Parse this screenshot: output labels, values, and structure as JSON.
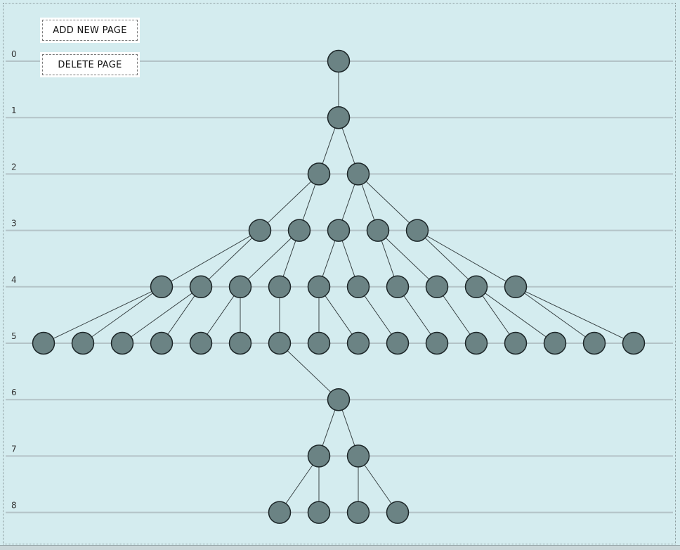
{
  "toolbar": {
    "add_label": "ADD NEW PAGE",
    "delete_label": "DELETE PAGE"
  },
  "levels": [
    "0",
    "1",
    "2",
    "3",
    "4",
    "5",
    "6",
    "7",
    "8"
  ],
  "colors": {
    "background": "#d4ecef",
    "node_fill": "#6b8384",
    "node_stroke": "#1c2628",
    "level_line": "#b3c3c7"
  },
  "tree": {
    "nodes": [
      {
        "id": "r",
        "level": 0
      },
      {
        "id": "a",
        "level": 1,
        "parent": "r"
      },
      {
        "id": "b1",
        "level": 2,
        "parent": "a"
      },
      {
        "id": "b2",
        "level": 2,
        "parent": "a"
      },
      {
        "id": "c1",
        "level": 3,
        "parent": "b1"
      },
      {
        "id": "c2",
        "level": 3,
        "parent": "b1"
      },
      {
        "id": "c3",
        "level": 3,
        "parent": "b2"
      },
      {
        "id": "c4",
        "level": 3,
        "parent": "b2"
      },
      {
        "id": "c5",
        "level": 3,
        "parent": "b2"
      },
      {
        "id": "d1",
        "level": 4,
        "parent": "c1"
      },
      {
        "id": "d2",
        "level": 4,
        "parent": "c1"
      },
      {
        "id": "d3",
        "level": 4,
        "parent": "c2"
      },
      {
        "id": "d4",
        "level": 4,
        "parent": "c2"
      },
      {
        "id": "d5",
        "level": 4,
        "parent": "c3"
      },
      {
        "id": "d6",
        "level": 4,
        "parent": "c3"
      },
      {
        "id": "d7",
        "level": 4,
        "parent": "c4"
      },
      {
        "id": "d8",
        "level": 4,
        "parent": "c4"
      },
      {
        "id": "d9",
        "level": 4,
        "parent": "c5"
      },
      {
        "id": "d10",
        "level": 4,
        "parent": "c5"
      },
      {
        "id": "e1",
        "level": 5,
        "parent": "d1"
      },
      {
        "id": "e2",
        "level": 5,
        "parent": "d1"
      },
      {
        "id": "e3",
        "level": 5,
        "parent": "d2"
      },
      {
        "id": "e4",
        "level": 5,
        "parent": "d2"
      },
      {
        "id": "e5",
        "level": 5,
        "parent": "d3"
      },
      {
        "id": "e6",
        "level": 5,
        "parent": "d3"
      },
      {
        "id": "e7",
        "level": 5,
        "parent": "d4"
      },
      {
        "id": "e8",
        "level": 5,
        "parent": "d5"
      },
      {
        "id": "e9",
        "level": 5,
        "parent": "d5"
      },
      {
        "id": "e10",
        "level": 5,
        "parent": "d6"
      },
      {
        "id": "e11",
        "level": 5,
        "parent": "d7"
      },
      {
        "id": "e12",
        "level": 5,
        "parent": "d8"
      },
      {
        "id": "e13",
        "level": 5,
        "parent": "d9"
      },
      {
        "id": "e14",
        "level": 5,
        "parent": "d9"
      },
      {
        "id": "e15",
        "level": 5,
        "parent": "d10"
      },
      {
        "id": "e16",
        "level": 5,
        "parent": "d10"
      },
      {
        "id": "f1",
        "level": 6,
        "parent": "e7"
      },
      {
        "id": "g1",
        "level": 7,
        "parent": "f1"
      },
      {
        "id": "g2",
        "level": 7,
        "parent": "f1"
      },
      {
        "id": "h1",
        "level": 8,
        "parent": "g1"
      },
      {
        "id": "h2",
        "level": 8,
        "parent": "g1"
      },
      {
        "id": "h3",
        "level": 8,
        "parent": "g2"
      },
      {
        "id": "h4",
        "level": 8,
        "parent": "g2"
      }
    ]
  }
}
